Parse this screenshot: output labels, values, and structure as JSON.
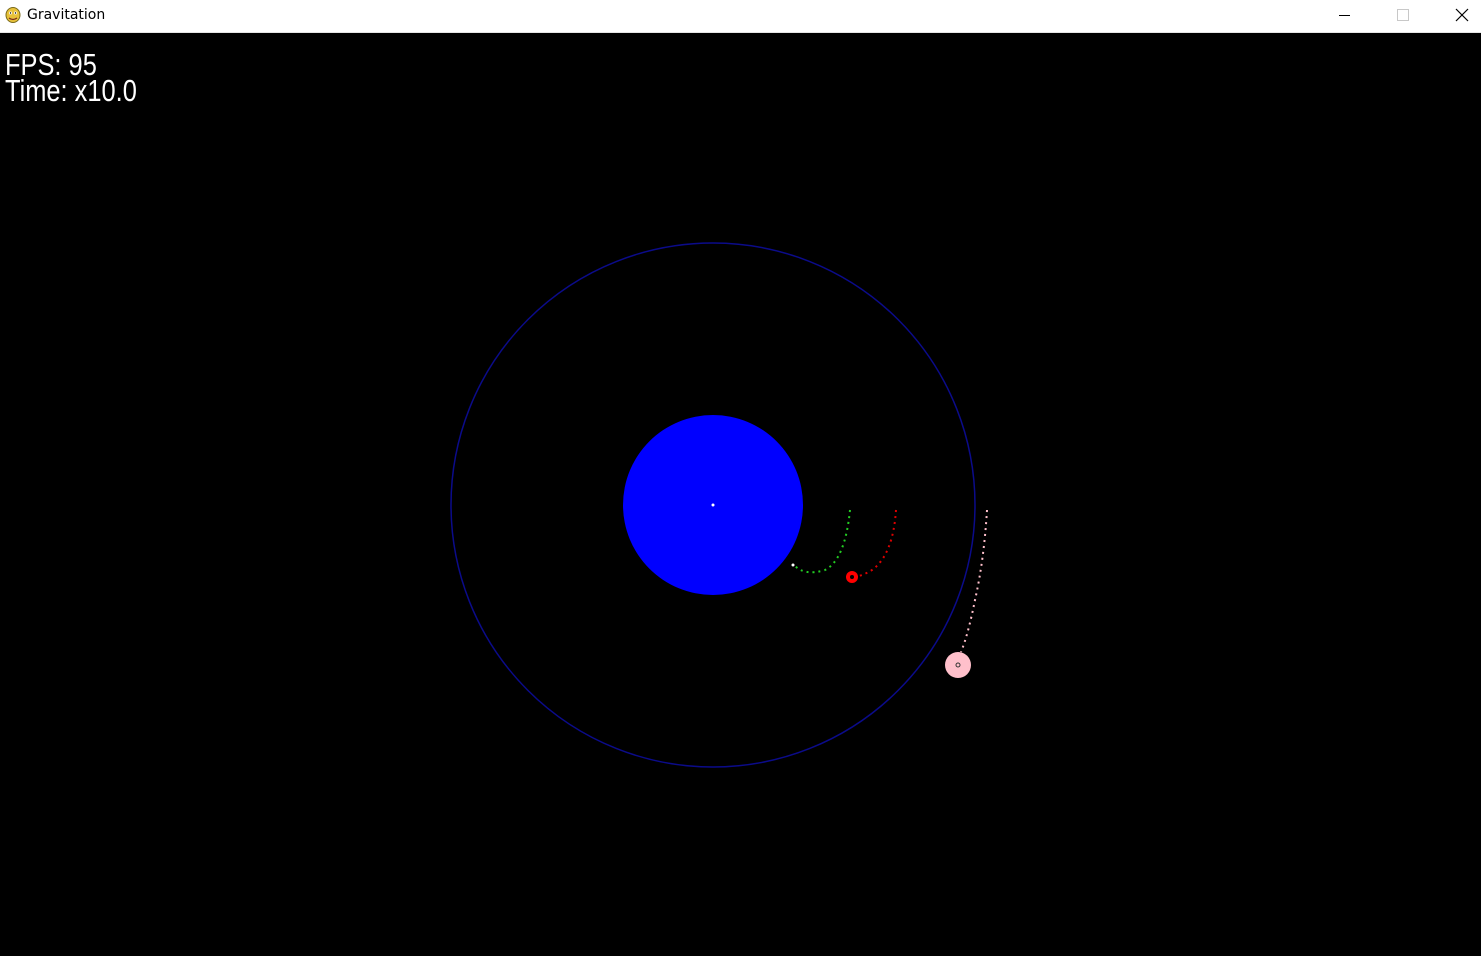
{
  "window": {
    "title": "Gravitation",
    "app_icon": "pygame-snake-icon",
    "controls": [
      "minimize-icon",
      "maximize-icon",
      "close-icon"
    ]
  },
  "hud": {
    "fps_text": "FPS: 95",
    "time_text": "Time: x10.0"
  },
  "scene": {
    "background_color": "#000000",
    "planet_color": "#0000ff",
    "orbit_ring_color": "#0b0b8a",
    "center_marker_color": "#ffffff",
    "bodies": [
      {
        "name": "green-satellite",
        "color": "#22cc22"
      },
      {
        "name": "red-satellite",
        "color": "#ff0000"
      },
      {
        "name": "pink-satellite",
        "color": "#ffc0cb"
      }
    ]
  }
}
